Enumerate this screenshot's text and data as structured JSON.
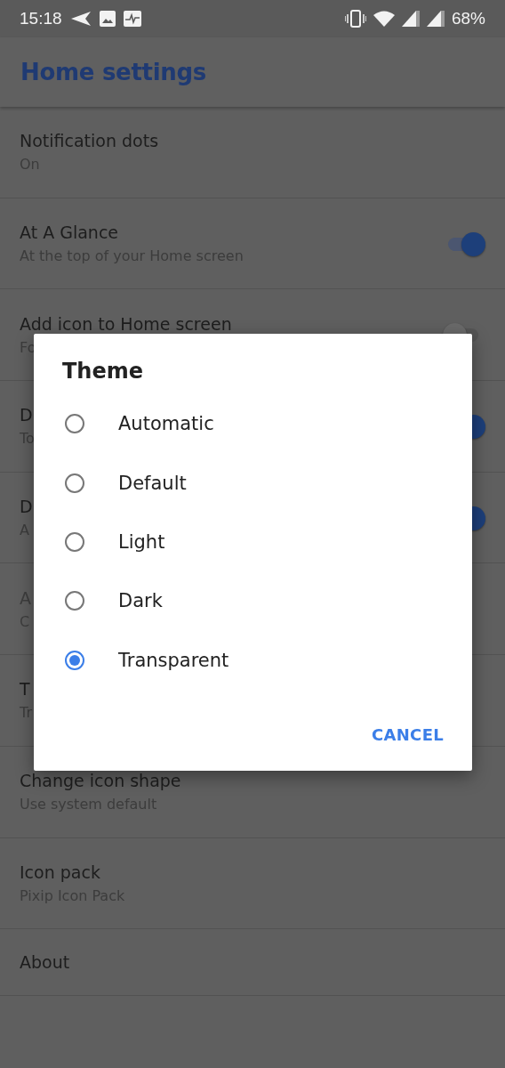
{
  "status_bar": {
    "time": "15:18",
    "battery": "68%"
  },
  "app_bar": {
    "title": "Home settings"
  },
  "settings": [
    {
      "title": "Notification dots",
      "subtitle": "On",
      "disabled": false
    },
    {
      "title": "At A Glance",
      "subtitle": "At the top of your Home screen",
      "disabled": false,
      "toggle_on": true
    },
    {
      "title": "Add icon to Home screen",
      "subtitle": "Fo",
      "disabled": false,
      "toggle_on": false
    },
    {
      "title": "D",
      "subtitle": "To",
      "disabled": false,
      "toggle_on": true
    },
    {
      "title": "D",
      "subtitle": "A",
      "disabled": false,
      "toggle_on": true
    },
    {
      "title": "A",
      "subtitle": "C",
      "disabled": true
    },
    {
      "title": "T",
      "subtitle": "Tr",
      "disabled": false
    },
    {
      "title": "Change icon shape",
      "subtitle": "Use system default",
      "disabled": false
    },
    {
      "title": "Icon pack",
      "subtitle": "Pixip Icon Pack",
      "disabled": false
    },
    {
      "title": "About",
      "disabled": false
    }
  ],
  "dialog": {
    "title": "Theme",
    "options": [
      {
        "label": "Automatic",
        "selected": false
      },
      {
        "label": "Default",
        "selected": false
      },
      {
        "label": "Light",
        "selected": false
      },
      {
        "label": "Dark",
        "selected": false
      },
      {
        "label": "Transparent",
        "selected": true
      }
    ],
    "button": "CANCEL"
  }
}
